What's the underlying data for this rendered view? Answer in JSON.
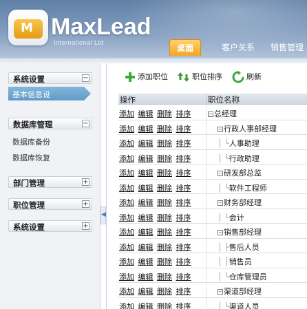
{
  "header": {
    "logo_text": "MaxLead",
    "logo_sub": "International Ltd",
    "logo_mark": "M",
    "tabs": [
      {
        "label": "桌面",
        "active": true
      },
      {
        "label": "客户关系",
        "active": false
      },
      {
        "label": "销售管理",
        "active": false
      }
    ]
  },
  "sidebar": {
    "sections": [
      {
        "title": "系统设置",
        "toggle": "−",
        "items": [
          "基本信息设"
        ]
      },
      {
        "title": "数据库管理",
        "toggle": "−",
        "items": [
          "数据库备份",
          "数据库恢复"
        ]
      },
      {
        "title": "部门管理",
        "toggle": "+"
      },
      {
        "title": "职位管理",
        "toggle": "+"
      },
      {
        "title": "系统设置",
        "toggle": "+"
      }
    ],
    "collapse_glyph": "◀"
  },
  "toolbar": {
    "add_label": "添加职位",
    "sort_label": "职位排序",
    "refresh_label": "刷新"
  },
  "table": {
    "headers": [
      "操作",
      "职位名称"
    ],
    "ops": [
      "添加",
      "编辑",
      "删除",
      "排序"
    ],
    "rows": [
      {
        "prefix": "⊟",
        "name": "总经理",
        "level": 0
      },
      {
        "prefix": "⊟",
        "name": "行政人事部经理",
        "level": 1
      },
      {
        "prefix": "│ └",
        "name": "人事助理",
        "level": 2
      },
      {
        "prefix": "│ └",
        "name": "行政助理",
        "level": 2
      },
      {
        "prefix": "⊟",
        "name": "研发部总监",
        "level": 1
      },
      {
        "prefix": "│ └",
        "name": "软件工程师",
        "level": 2
      },
      {
        "prefix": "⊟",
        "name": "财务部经理",
        "level": 1
      },
      {
        "prefix": "│ └",
        "name": "会计",
        "level": 2
      },
      {
        "prefix": "⊟",
        "name": "销售部经理",
        "level": 1
      },
      {
        "prefix": "│ ├",
        "name": "售后人员",
        "level": 2
      },
      {
        "prefix": "│ │",
        "name": "销售员",
        "level": 2
      },
      {
        "prefix": "│ └",
        "name": "仓库管理员",
        "level": 2
      },
      {
        "prefix": "⊟",
        "name": "渠道部经理",
        "level": 1
      },
      {
        "prefix": "│ └",
        "name": "渠道人员",
        "level": 2
      }
    ]
  }
}
